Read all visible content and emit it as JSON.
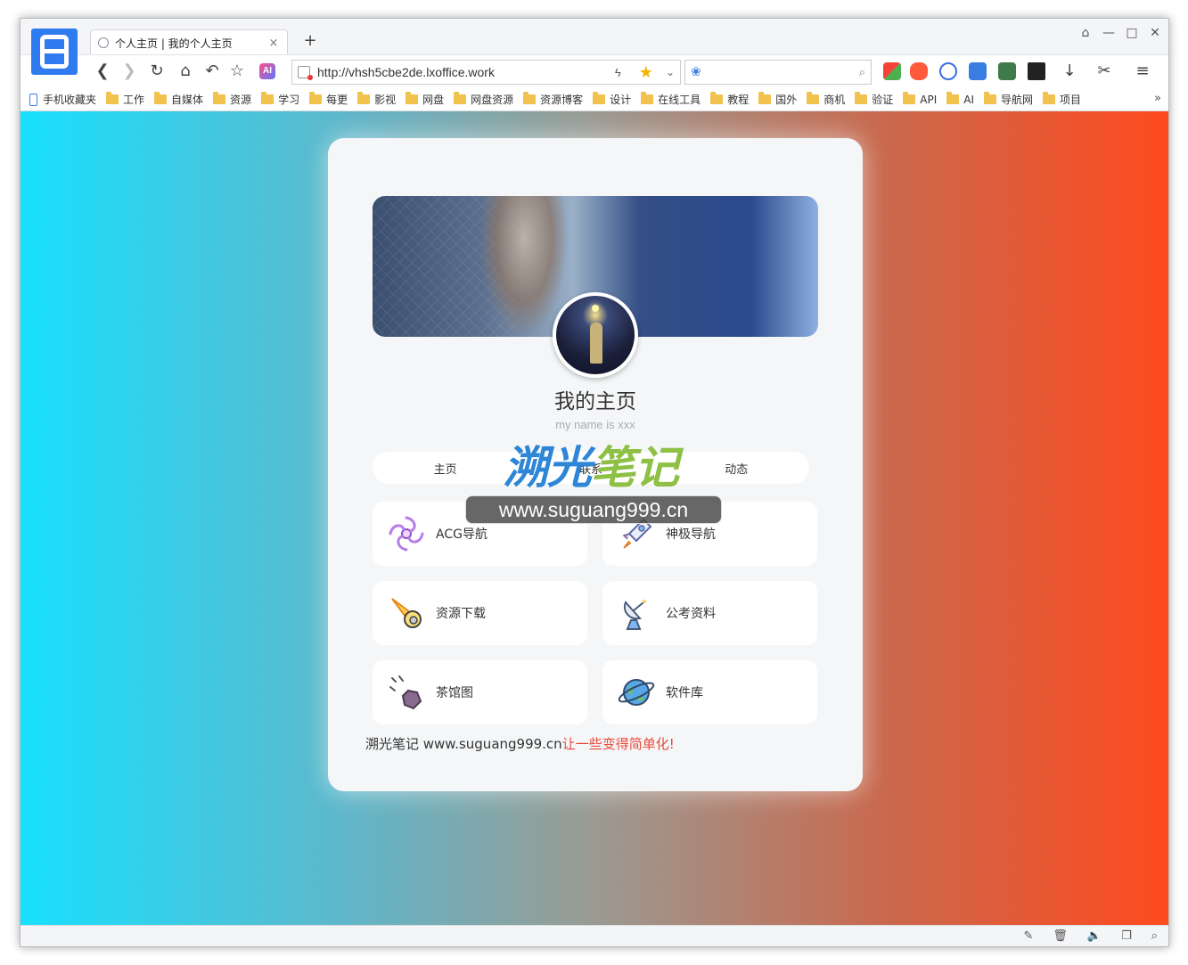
{
  "browser": {
    "tab_title": "个人主页 | 我的个人主页",
    "tab_close": "×",
    "new_tab": "+",
    "window_controls": [
      "⌂",
      "—",
      "□",
      "✕"
    ],
    "url": "http://vhsh5cbe2de.lxoffice.work",
    "bookmarks": [
      "手机收藏夹",
      "工作",
      "自媒体",
      "资源",
      "学习",
      "每更",
      "影视",
      "网盘",
      "网盘资源",
      "资源博客",
      "设计",
      "在线工具",
      "教程",
      "国外",
      "商机",
      "验证",
      "API",
      "AI",
      "导航网",
      "项目"
    ],
    "bookmarks_more": "»",
    "ai_badge": "AI"
  },
  "profile": {
    "name": "我的主页",
    "subtitle": "my name is xxx"
  },
  "tabs": [
    "主页",
    "联系",
    "动态"
  ],
  "tiles": [
    {
      "label": "ACG导航",
      "icon": "galaxy-icon"
    },
    {
      "label": "神极导航",
      "icon": "rocket-icon"
    },
    {
      "label": "资源下载",
      "icon": "comet-icon"
    },
    {
      "label": "公考资料",
      "icon": "satellite-dish-icon"
    },
    {
      "label": "茶馆图",
      "icon": "meteor-icon"
    },
    {
      "label": "软件库",
      "icon": "planet-icon"
    }
  ],
  "footer": {
    "main": "溯光笔记 www.suguang999.cn",
    "highlight": "让一些变得简单化!"
  },
  "watermark": {
    "logo_part1": "溯光",
    "logo_part2": "笔记",
    "url": "www.suguang999.cn"
  },
  "colors": {
    "gradient_left": "#18e0ff",
    "gradient_right": "#ff4a1e",
    "footer_highlight": "#e84b3c",
    "browser_accent": "#2f7cf0"
  }
}
